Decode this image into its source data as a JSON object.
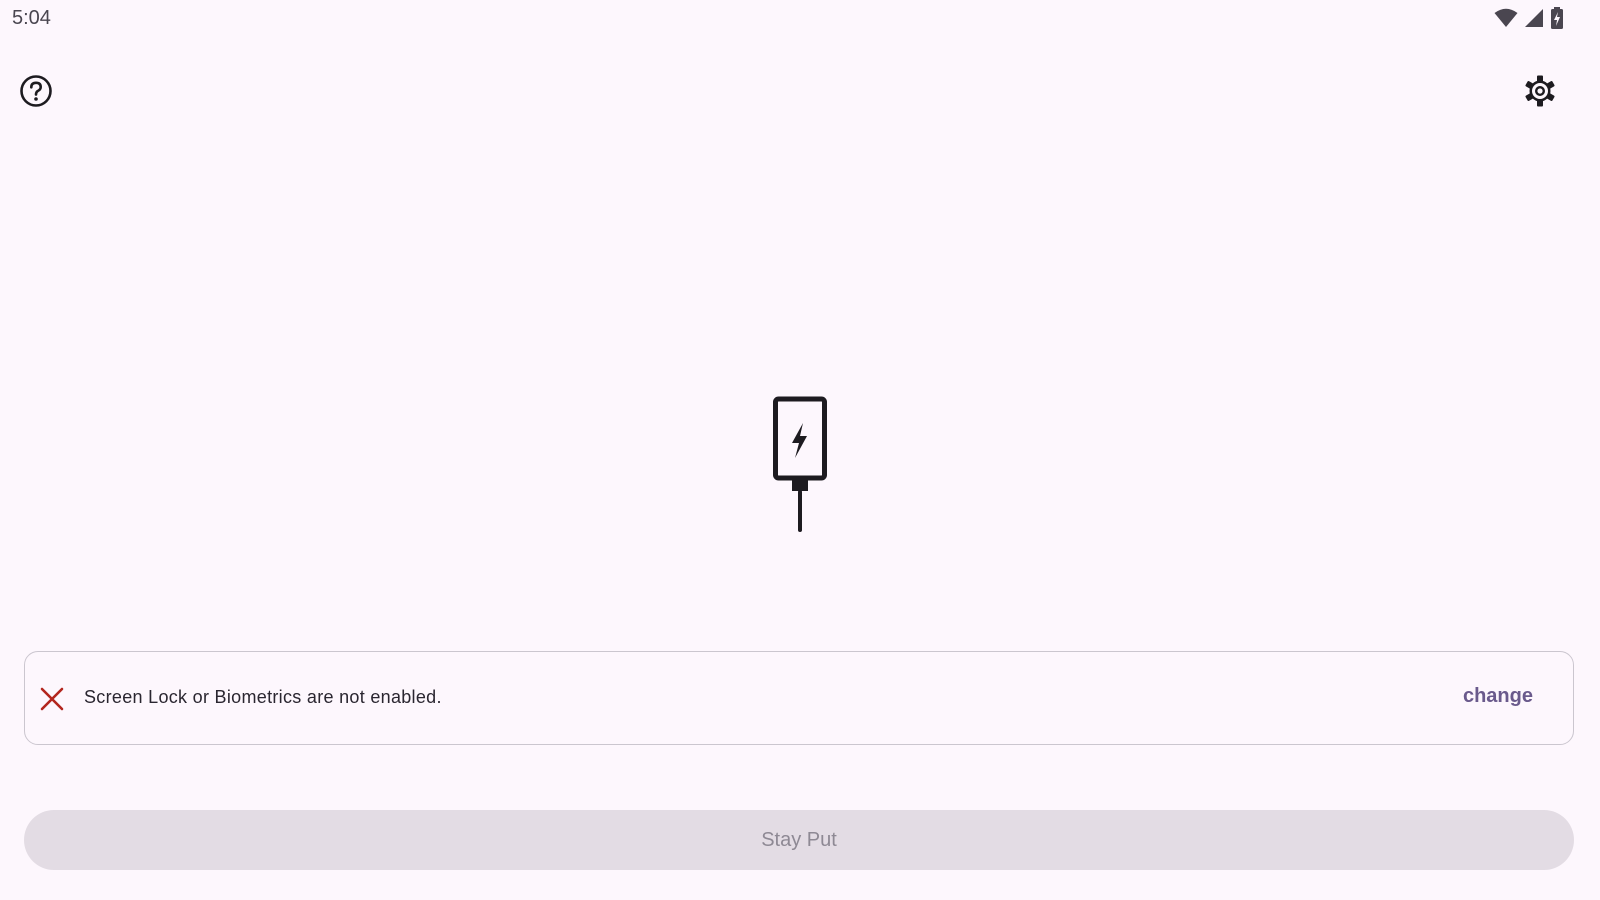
{
  "status_bar": {
    "time": "5:04",
    "icons": [
      "wifi-icon",
      "cellular-signal-icon",
      "battery-charging-icon"
    ]
  },
  "toolbar": {
    "help_icon": "help-circle-icon",
    "settings_icon": "gear-icon"
  },
  "hero": {
    "icon": "phone-charging-icon"
  },
  "warning": {
    "icon": "close-x-icon",
    "message": "Screen Lock or Biometrics are not enabled.",
    "action_label": "change"
  },
  "primary_action": {
    "label": "Stay Put",
    "enabled": false
  },
  "colors": {
    "background": "#fdf7fd",
    "error": "#b3261e",
    "accent": "#6a5a8c",
    "disabled_button": "#e3dce4",
    "disabled_text": "#8e8994"
  }
}
